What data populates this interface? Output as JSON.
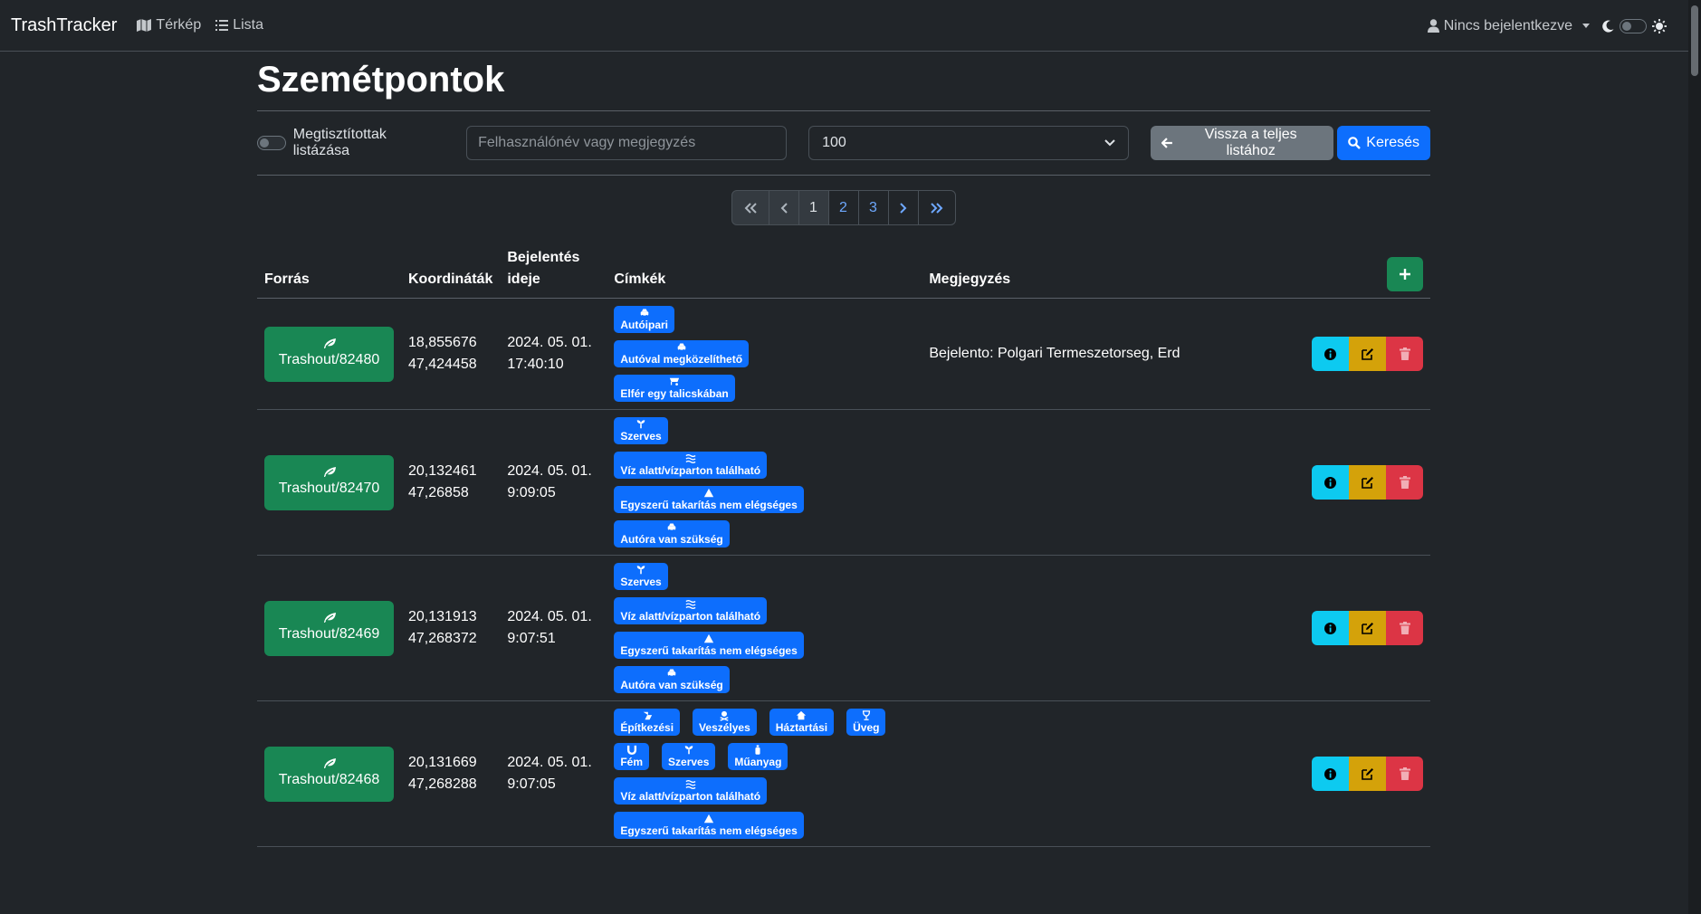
{
  "navbar": {
    "brand": "TrashTracker",
    "map_label": "Térkép",
    "list_label": "Lista",
    "user_label": "Nincs bejelentkezve"
  },
  "page": {
    "title": "Szemétpontok"
  },
  "filters": {
    "cleaned_label": "Megtisztítottak listázása",
    "search_placeholder": "Felhasználónév vagy megjegyzés",
    "page_size_value": "100",
    "back_label": "Vissza a teljes listához",
    "search_label": "Keresés"
  },
  "pagination": {
    "pages": [
      "1",
      "2",
      "3"
    ],
    "current": "1"
  },
  "table": {
    "headers": {
      "source": "Forrás",
      "coords": "Koordináták",
      "reported_1": "Bejelentés",
      "reported_2": "ideje",
      "tags": "Címkék",
      "note": "Megjegyzés"
    },
    "rows": [
      {
        "source": "Trashout/82480",
        "lon": "18,855676",
        "lat": "47,424458",
        "date": "2024. 05. 01.",
        "time": "17:40:10",
        "note": "Bejelento: Polgari Termeszetorseg, Erd",
        "tags": [
          "Autóipari",
          "Autóval megközelíthető",
          "Elfér egy talicskában"
        ]
      },
      {
        "source": "Trashout/82470",
        "lon": "20,132461",
        "lat": "47,26858",
        "date": "2024. 05. 01.",
        "time": "9:09:05",
        "note": "",
        "tags": [
          "Szerves",
          "Víz alatt/vízparton található",
          "Egyszerű takarítás nem elégséges",
          "Autóra van szükség"
        ]
      },
      {
        "source": "Trashout/82469",
        "lon": "20,131913",
        "lat": "47,268372",
        "date": "2024. 05. 01.",
        "time": "9:07:51",
        "note": "",
        "tags": [
          "Szerves",
          "Víz alatt/vízparton található",
          "Egyszerű takarítás nem elégséges",
          "Autóra van szükség"
        ]
      },
      {
        "source": "Trashout/82468",
        "lon": "20,131669",
        "lat": "47,268288",
        "date": "2024. 05. 01.",
        "time": "9:07:05",
        "note": "",
        "tags": [
          "Építkezési",
          "Veszélyes",
          "Háztartási",
          "Üveg",
          "Fém",
          "Szerves",
          "Műanyag",
          "Víz alatt/vízparton található",
          "Egyszerű takarítás nem elégséges"
        ]
      }
    ]
  },
  "colors": {
    "background": "#212529",
    "primary": "#0d6efd",
    "success": "#198754",
    "info": "#0dcaf0",
    "warning": "#d4a20a",
    "danger": "#dc3545"
  }
}
